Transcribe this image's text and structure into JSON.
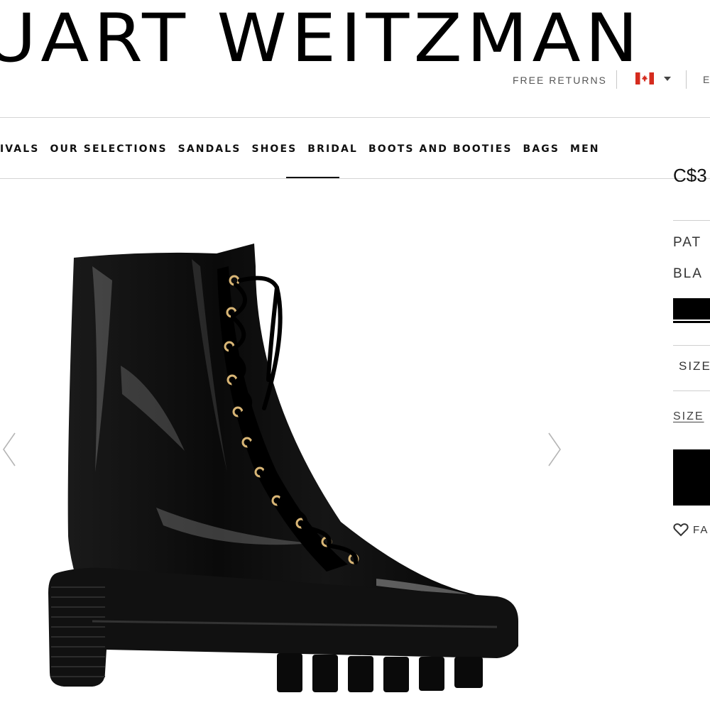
{
  "header": {
    "brand": "UART WEITZMAN",
    "free_returns": "FREE RETURNS",
    "country_flag_icon": "canada-flag-icon",
    "language_partial": "E"
  },
  "nav": {
    "items": [
      {
        "label": "IVALS"
      },
      {
        "label": "OUR SELECTIONS"
      },
      {
        "label": "SANDALS"
      },
      {
        "label": "SHOES",
        "active": true
      },
      {
        "label": "BRIDAL"
      },
      {
        "label": "BOOTS AND BOOTIES"
      },
      {
        "label": "BAGS"
      },
      {
        "label": "MEN"
      }
    ]
  },
  "gallery": {
    "prev_icon": "chevron-left-icon",
    "next_icon": "chevron-right-icon",
    "product_image": "black patent leather lace-up combat boot"
  },
  "product": {
    "price_partial": "C$3",
    "material_partial": "PAT",
    "color_partial": "BLA",
    "swatch_color": "#000000",
    "size_select_partial": "SIZE",
    "size_guide_partial": "SIZE",
    "favorite_partial": "FA"
  },
  "colors": {
    "text": "#111111",
    "muted": "#555555",
    "rule": "#d4d4d4"
  }
}
